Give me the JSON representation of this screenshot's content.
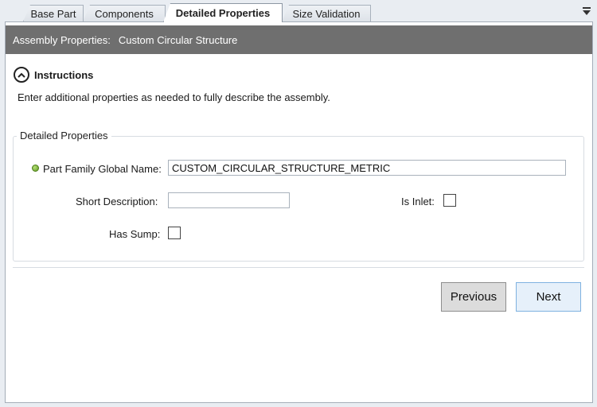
{
  "tabs": [
    {
      "label": "Base Part"
    },
    {
      "label": "Components"
    },
    {
      "label": "Detailed Properties"
    },
    {
      "label": "Size Validation"
    }
  ],
  "header": {
    "label": "Assembly Properties:",
    "value": "Custom Circular Structure"
  },
  "instructions": {
    "title": "Instructions",
    "text": "Enter additional properties as needed to fully describe the assembly."
  },
  "group": {
    "title": "Detailed Properties",
    "part_family_label": "Part Family Global Name:",
    "part_family_value": "CUSTOM_CIRCULAR_STRUCTURE_METRIC",
    "short_description_label": "Short Description:",
    "short_description_value": "",
    "is_inlet_label": "Is Inlet:",
    "is_inlet_checked": false,
    "has_sump_label": "Has Sump:",
    "has_sump_checked": false
  },
  "buttons": {
    "previous": "Previous",
    "next": "Next"
  },
  "colors": {
    "header_bg": "#6f6f6f",
    "status_dot": "#5f9a1f",
    "next_border": "#7fb2e0"
  }
}
